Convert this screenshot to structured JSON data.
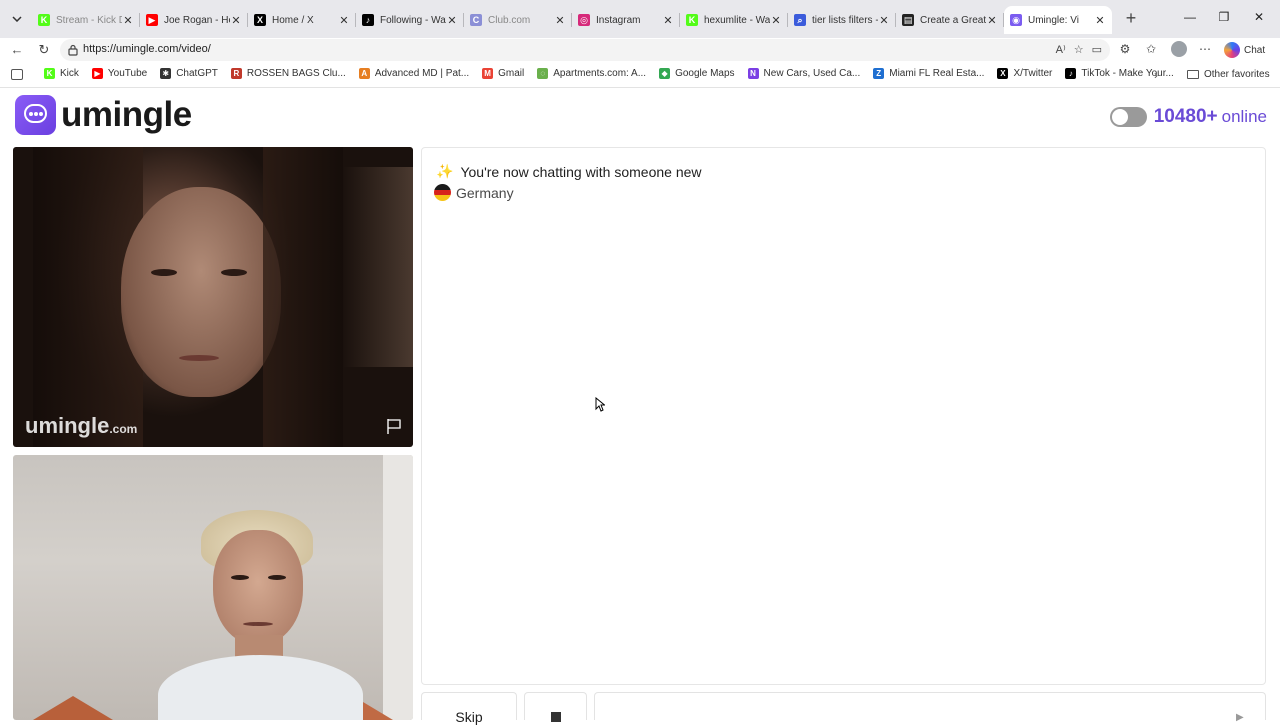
{
  "browser": {
    "tabs": [
      {
        "title": "Stream - Kick Da",
        "color": "#53fc18",
        "letter": "K",
        "faded": true
      },
      {
        "title": "Joe Rogan - He I",
        "color": "#ff0000",
        "letter": "▶",
        "faded": false
      },
      {
        "title": "Home / X",
        "color": "#000000",
        "letter": "X",
        "faded": false
      },
      {
        "title": "Following - Watc",
        "color": "#010101",
        "letter": "♪",
        "faded": false
      },
      {
        "title": "Club.com",
        "color": "#8b8fd6",
        "letter": "C",
        "faded": true
      },
      {
        "title": "Instagram",
        "color": "#d6297a",
        "letter": "◎",
        "faded": false
      },
      {
        "title": "hexumlite - Watc",
        "color": "#53fc18",
        "letter": "K",
        "faded": false
      },
      {
        "title": "tier lists filters - S",
        "color": "#3b5bdb",
        "letter": "⌕",
        "faded": false
      },
      {
        "title": "Create a Greater",
        "color": "#222222",
        "letter": "▤",
        "faded": false
      },
      {
        "title": "Umingle: Vi",
        "color": "#7b5cf0",
        "letter": "◉",
        "faded": false,
        "active": true
      }
    ],
    "url": "https://umingle.com/video/",
    "chat_label": "Chat",
    "bookmarks": [
      {
        "label": "Kick",
        "color": "#53fc18",
        "letter": "K"
      },
      {
        "label": "YouTube",
        "color": "#ff0000",
        "letter": "▶"
      },
      {
        "label": "ChatGPT",
        "color": "#333333",
        "letter": "✱"
      },
      {
        "label": "ROSSEN BAGS Clu...",
        "color": "#c0392b",
        "letter": "R"
      },
      {
        "label": "Advanced MD | Pat...",
        "color": "#e67e22",
        "letter": "A"
      },
      {
        "label": "Gmail",
        "color": "#ea4335",
        "letter": "M"
      },
      {
        "label": "Apartments.com: A...",
        "color": "#6ab04c",
        "letter": "◌"
      },
      {
        "label": "Google Maps",
        "color": "#34a853",
        "letter": "◆"
      },
      {
        "label": "New Cars, Used Ca...",
        "color": "#7b3fe4",
        "letter": "N"
      },
      {
        "label": "Miami FL Real Esta...",
        "color": "#1f6fd1",
        "letter": "Z"
      },
      {
        "label": "X/Twitter",
        "color": "#000000",
        "letter": "X"
      },
      {
        "label": "TikTok - Make Your...",
        "color": "#010101",
        "letter": "♪"
      }
    ],
    "other_favorites": "Other favorites"
  },
  "site": {
    "logo_text": "umingle",
    "online_count": "10480+",
    "online_label": "online",
    "toggle_on": false,
    "accent": "#6a4bd6"
  },
  "stranger_video": {
    "watermark": "umingle",
    "watermark_domain": ".com"
  },
  "chat": {
    "system_message": "You're now chatting with someone new",
    "country": "Germany"
  },
  "controls": {
    "skip_label": "Skip",
    "message_placeholder": ""
  }
}
